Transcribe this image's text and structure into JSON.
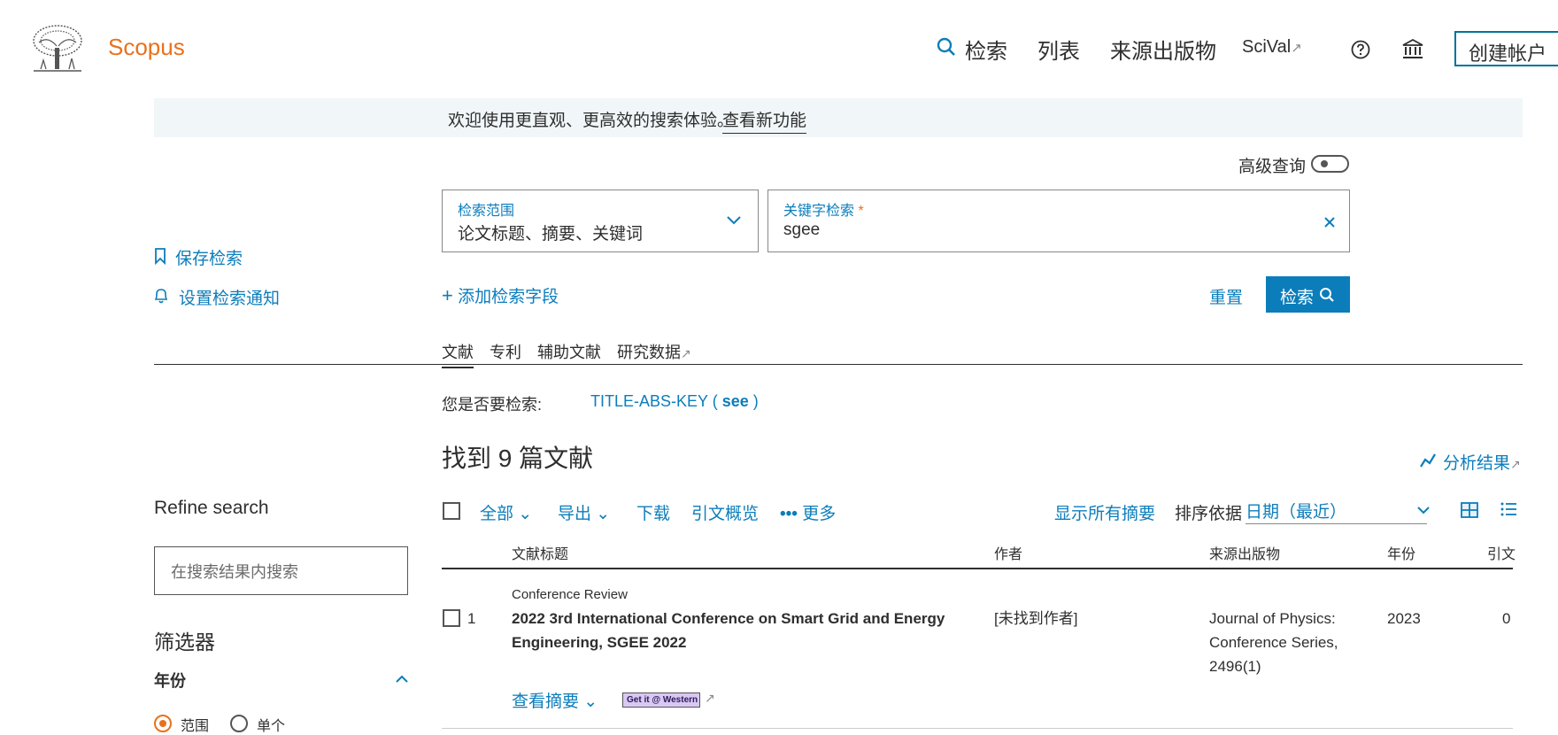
{
  "header": {
    "brand": "Scopus",
    "nav": {
      "search": "检索",
      "lists": "列表",
      "sources": "来源出版物",
      "scival": "SciVal",
      "create_account": "创建帐户"
    }
  },
  "banner": {
    "text": "欢迎使用更直观、更高效的搜索体验。",
    "link": "查看新功能"
  },
  "search": {
    "advanced_label": "高级查询",
    "scope_label": "检索范围",
    "scope_value": "论文标题、摘要、关键词",
    "keyword_label": "关键字检索",
    "keyword_required": "*",
    "keyword_value": "sgee",
    "add_field": "添加检索字段",
    "reset": "重置",
    "search_button": "检索"
  },
  "left_actions": {
    "save_search": "保存检索",
    "set_alert": "设置检索通知"
  },
  "tabs": [
    "文献",
    "专利",
    "辅助文献",
    "研究数据"
  ],
  "did_you_mean": {
    "label": "您是否要检索:",
    "prefix": "TITLE-ABS-KEY ( ",
    "term": "see",
    "suffix": " )"
  },
  "results": {
    "count_text": "找到 9 篇文献",
    "analyze": "分析结果"
  },
  "refine": {
    "title": "Refine search",
    "placeholder": "在搜索结果内搜索",
    "filters_title": "筛选器",
    "year_label": "年份",
    "range_label": "范围",
    "single_label": "单个"
  },
  "toolbar": {
    "all": "全部",
    "export": "导出",
    "download": "下载",
    "citation_overview": "引文概览",
    "more": "更多",
    "show_abstracts": "显示所有摘要",
    "sort_label": "排序依据",
    "sort_value": "日期（最近）"
  },
  "table": {
    "columns": [
      "文献标题",
      "作者",
      "来源出版物",
      "年份",
      "引文"
    ],
    "rows": [
      {
        "index": "1",
        "doc_type": "Conference Review",
        "title": "2022 3rd International Conference on Smart Grid and Energy Engineering, SGEE 2022",
        "authors": "[未找到作者]",
        "source_line1": "Journal of Physics:",
        "source_line2": "Conference Series,",
        "source_line3": "2496(1)",
        "year": "2023",
        "citations": "0",
        "view_abstract": "查看摘要",
        "getit": "Get it @ Western"
      }
    ]
  }
}
